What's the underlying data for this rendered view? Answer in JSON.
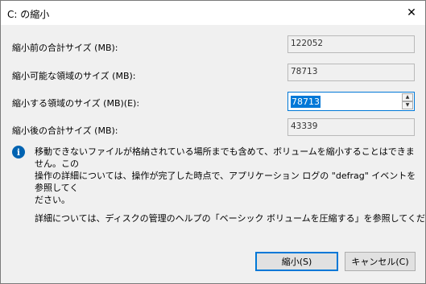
{
  "window": {
    "title": "C: の縮小",
    "close_glyph": "✕"
  },
  "fields": {
    "total_before": {
      "label": "縮小前の合計サイズ (MB):",
      "value": "122052"
    },
    "shrinkable": {
      "label": "縮小可能な領域のサイズ (MB):",
      "value": "78713"
    },
    "shrink_amount": {
      "label": "縮小する領域のサイズ (MB)(E):",
      "value": "78713"
    },
    "total_after": {
      "label": "縮小後の合計サイズ (MB):",
      "value": "43339"
    }
  },
  "info": {
    "icon": "info-icon",
    "text": "移動できないファイルが格納されている場所までも含めて、ボリュームを縮小することはできません。この\n操作の詳細については、操作が完了した時点で、アプリケーション ログの \"defrag\" イベントを参照してく\nださい。",
    "help_text": "詳細については、ディスクの管理のヘルプの「ベーシック ボリュームを圧縮する」を参照してください"
  },
  "buttons": {
    "shrink": "縮小(S)",
    "cancel": "キャンセル(C)"
  },
  "colors": {
    "accent": "#0078d7",
    "info_icon": "#0063b1"
  }
}
